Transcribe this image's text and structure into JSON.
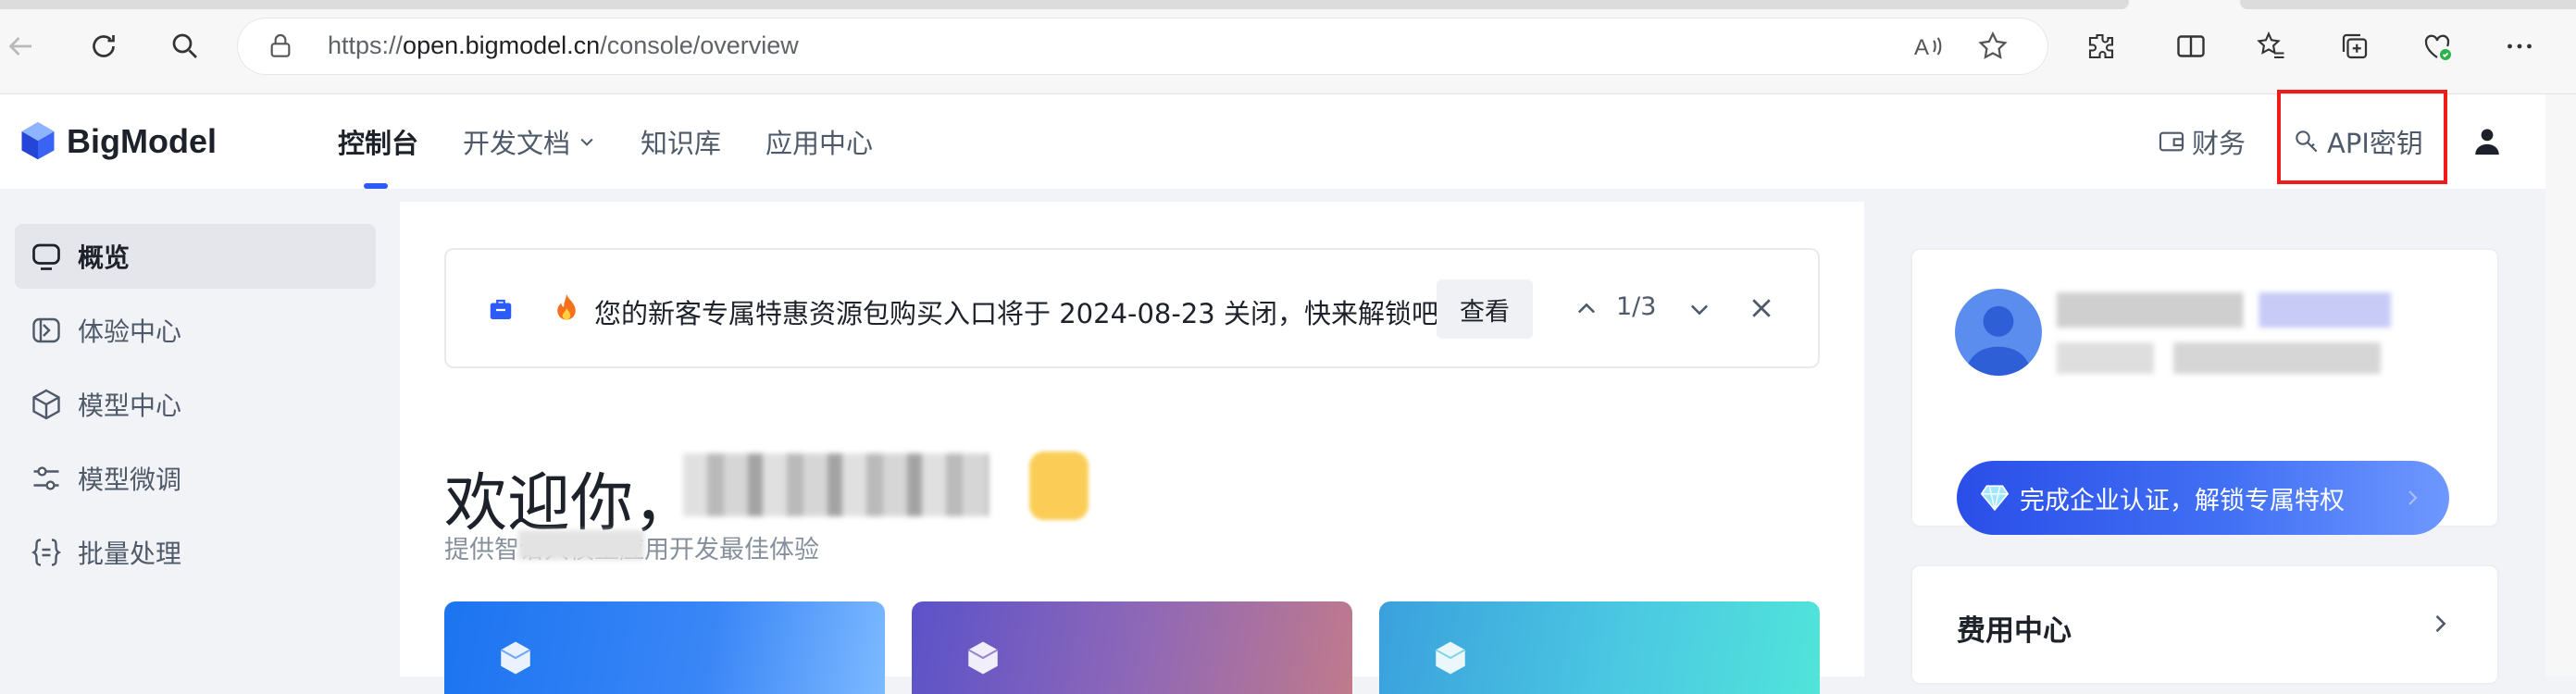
{
  "browser": {
    "url_prefix": "https://",
    "url_domain": "open.bigmodel.cn",
    "url_path": "/console/overview"
  },
  "header": {
    "brand": "BigModel",
    "nav": [
      {
        "label": "控制台",
        "active": true
      },
      {
        "label": "开发文档",
        "has_dropdown": true
      },
      {
        "label": "知识库"
      },
      {
        "label": "应用中心"
      }
    ],
    "finance_label": "财务",
    "apikey_label": "API密钥"
  },
  "sidebar": {
    "items": [
      {
        "label": "概览",
        "icon": "chat-icon",
        "active": true
      },
      {
        "label": "体验中心",
        "icon": "experience-icon"
      },
      {
        "label": "模型中心",
        "icon": "cube-icon"
      },
      {
        "label": "模型微调",
        "icon": "sliders-icon"
      },
      {
        "label": "批量处理",
        "icon": "braces-icon"
      }
    ]
  },
  "notice": {
    "text": "您的新客专属特惠资源包购买入口将于 2024-08-23 关闭，快来解锁吧",
    "view_label": "查看",
    "pager": "1/3"
  },
  "welcome": {
    "greeting": "欢迎你，",
    "subtitle": "提供智谱大模型应用开发最佳体验"
  },
  "profile": {
    "enterprise_label": "完成企业认证，解锁专属特权"
  },
  "fee": {
    "title": "费用中心"
  },
  "colors": {
    "accent": "#2c5bf6",
    "highlight": "#ee1c1c"
  }
}
